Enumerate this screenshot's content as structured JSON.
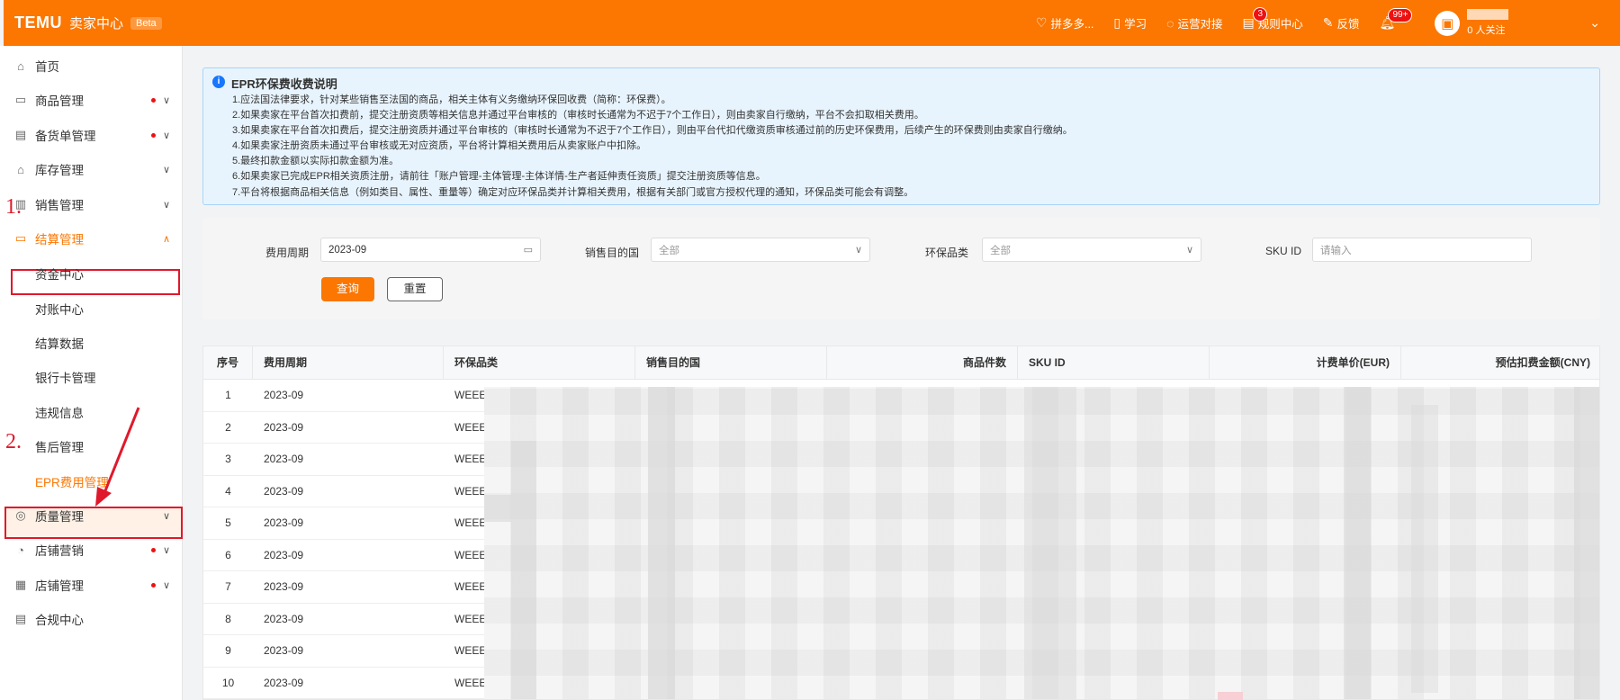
{
  "header": {
    "logo": "TEMU",
    "subtitle": "卖家中心",
    "beta": "Beta",
    "items": [
      {
        "label": "拼多多...",
        "icon": "heart-icon"
      },
      {
        "label": "学习",
        "icon": "book-icon"
      },
      {
        "label": "运营对接",
        "icon": "chat-icon"
      },
      {
        "label": "规则中心",
        "icon": "calendar-icon",
        "badge": "3"
      },
      {
        "label": "反馈",
        "icon": "edit-icon"
      },
      {
        "label": "",
        "icon": "bell-icon",
        "badge": "99+"
      }
    ],
    "follow": "0 人关注"
  },
  "sidebar": {
    "items": [
      {
        "label": "首页",
        "icon": "home-icon",
        "dot": false,
        "chevron": false
      },
      {
        "label": "商品管理",
        "icon": "product-icon",
        "dot": true,
        "chevron": true
      },
      {
        "label": "备货单管理",
        "icon": "order-icon",
        "dot": true,
        "chevron": true
      },
      {
        "label": "库存管理",
        "icon": "warehouse-icon",
        "dot": false,
        "chevron": true
      },
      {
        "label": "销售管理",
        "icon": "chart-icon",
        "dot": false,
        "chevron": true
      },
      {
        "label": "结算管理",
        "icon": "wallet-icon",
        "dot": false,
        "chevron": true
      }
    ],
    "sub_items": [
      "资金中心",
      "对账中心",
      "结算数据",
      "银行卡管理",
      "违规信息",
      "售后管理",
      "EPR费用管理"
    ],
    "bottom_items": [
      {
        "label": "质量管理",
        "icon": "quality-icon",
        "dot": false,
        "chevron": true
      },
      {
        "label": "店铺营销",
        "icon": "marketing-icon",
        "dot": true,
        "chevron": true
      },
      {
        "label": "店铺管理",
        "icon": "store-icon",
        "dot": true,
        "chevron": true
      },
      {
        "label": "合规中心",
        "icon": "compliance-icon",
        "dot": false,
        "chevron": false
      }
    ],
    "annotations": [
      "1.",
      "2."
    ]
  },
  "notice": {
    "title": "EPR环保费收费说明",
    "lines": [
      "1.应法国法律要求，针对某些销售至法国的商品，相关主体有义务缴纳环保回收费（简称：环保费）。",
      "2.如果卖家在平台首次扣费前，提交注册资质等相关信息并通过平台审核的（审核时长通常为不迟于7个工作日），则由卖家自行缴纳，平台不会扣取相关费用。",
      "3.如果卖家在平台首次扣费后，提交注册资质并通过平台审核的（审核时长通常为不迟于7个工作日），则由平台代扣代缴资质审核通过前的历史环保费用，后续产生的环保费则由卖家自行缴纳。",
      "4.如果卖家注册资质未通过平台审核或无对应资质，平台将计算相关费用后从卖家账户中扣除。",
      "5.最终扣款金额以实际扣款金额为准。",
      "6.如果卖家已完成EPR相关资质注册，请前往「账户管理-主体管理-主体详情-生产者延伸责任资质」提交注册资质等信息。",
      "7.平台将根据商品相关信息（例如类目、属性、重量等）确定对应环保品类并计算相关费用，根据有关部门或官方授权代理的通知，环保品类可能会有调整。"
    ]
  },
  "filter": {
    "period_label": "费用周期",
    "period_value": "2023-09",
    "country_label": "销售目的国",
    "country_placeholder": "全部",
    "category_label": "环保品类",
    "category_placeholder": "全部",
    "sku_label": "SKU ID",
    "sku_placeholder": "请输入",
    "query": "查询",
    "reset": "重置"
  },
  "table": {
    "columns": [
      "序号",
      "费用周期",
      "环保品类",
      "销售目的国",
      "商品件数",
      "SKU ID",
      "计费单价(EUR)",
      "预估扣费金额(CNY)"
    ],
    "rows": [
      {
        "no": "1",
        "period": "2023-09",
        "category": "WEEE"
      },
      {
        "no": "2",
        "period": "2023-09",
        "category": "WEEE"
      },
      {
        "no": "3",
        "period": "2023-09",
        "category": "WEEE"
      },
      {
        "no": "4",
        "period": "2023-09",
        "category": "WEEE"
      },
      {
        "no": "5",
        "period": "2023-09",
        "category": "WEEE"
      },
      {
        "no": "6",
        "period": "2023-09",
        "category": "WEEE"
      },
      {
        "no": "7",
        "period": "2023-09",
        "category": "WEEE"
      },
      {
        "no": "8",
        "period": "2023-09",
        "category": "WEEE"
      },
      {
        "no": "9",
        "period": "2023-09",
        "category": "WEEE"
      },
      {
        "no": "10",
        "period": "2023-09",
        "category": "WEEE"
      }
    ]
  },
  "colors": {
    "accent": "#fb7701",
    "annotation": "#e0182b"
  }
}
